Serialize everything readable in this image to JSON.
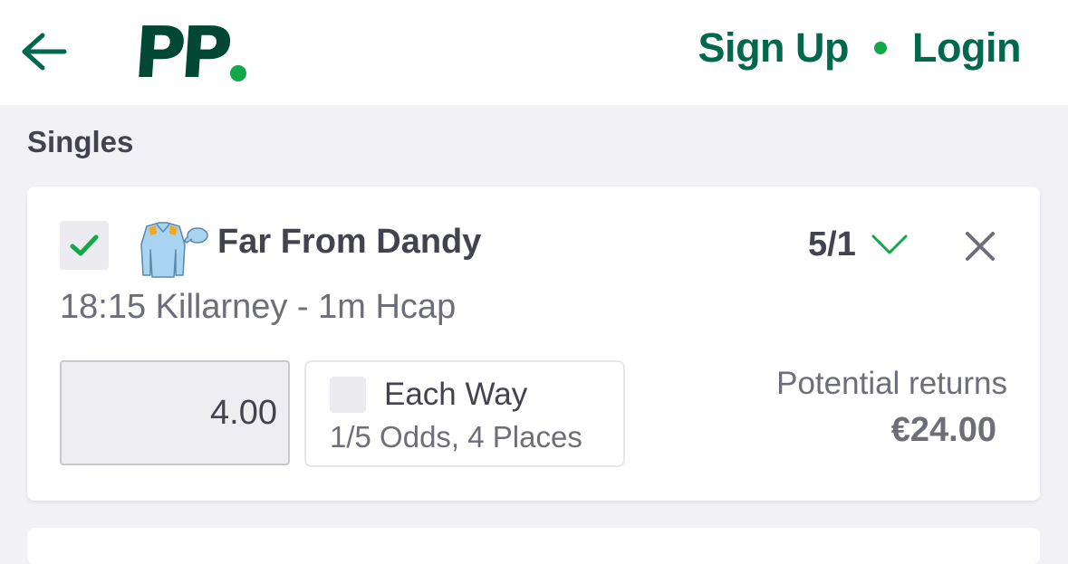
{
  "header": {
    "logo_text": "PP",
    "signup_label": "Sign Up",
    "login_label": "Login"
  },
  "betslip": {
    "section_title": "Singles",
    "selection": {
      "name": "Far From Dandy",
      "odds": "5/1",
      "event": "18:15 Killarney - 1m Hcap",
      "stake": "4.00",
      "each_way_label": "Each Way",
      "each_way_terms": "1/5 Odds, 4 Places",
      "returns_label": "Potential returns",
      "returns_value": "€24.00",
      "selected": true,
      "each_way_checked": false
    }
  },
  "icons": {
    "back": "arrow-left-icon",
    "checkbox": "checkmark-icon",
    "silks": "jockey-silks-icon",
    "odds_dropdown": "chevron-down-icon",
    "remove": "close-icon"
  },
  "colors": {
    "brand_dark": "#004833",
    "brand_green": "#00694d",
    "accent_green": "#11a84a",
    "text": "#43434f",
    "muted_text": "#6e6e78",
    "background": "#f1f1f6",
    "silks_blue": "#a8d4f2",
    "silks_orange": "#f5a623"
  }
}
